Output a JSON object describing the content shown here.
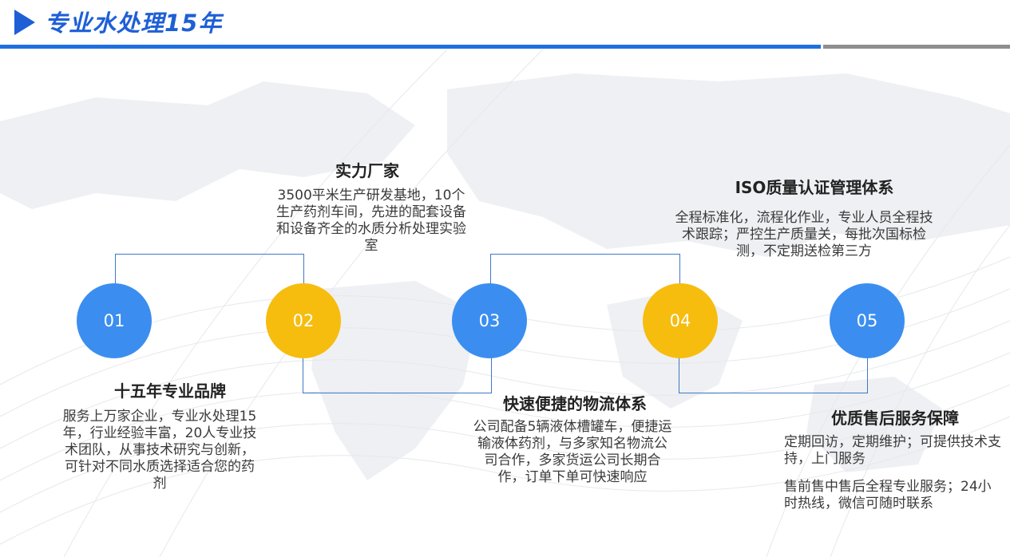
{
  "header": {
    "title": "专业水处理15年"
  },
  "colors": {
    "accent_blue": "#1e5fd6",
    "circle_blue": "#3b8ef0",
    "circle_gold": "#f6bd0e",
    "connector": "#3f78c8"
  },
  "steps": [
    {
      "number": "01",
      "title": "十五年专业品牌",
      "text": "服务上万家企业，专业水处理15年，行业经验丰富，20人专业技术团队，从事技术研究与创新，可针对不同水质选择适合您的药剂"
    },
    {
      "number": "02",
      "title": "实力厂家",
      "text": "3500平米生产研发基地，10个生产药剂车间，先进的配套设备和设备齐全的水质分析处理实验室"
    },
    {
      "number": "03",
      "title": "快速便捷的物流体系",
      "text": "公司配备5辆液体槽罐车，便捷运输液体药剂，与多家知名物流公司合作，多家货运公司长期合作，订单下单可快速响应"
    },
    {
      "number": "04",
      "title": "ISO质量认证管理体系",
      "text": "全程标准化，流程化作业，专业人员全程技术跟踪；严控生产质量关，每批次国标检测，不定期送检第三方"
    },
    {
      "number": "05",
      "title": "优质售后服务保障",
      "text": "定期回访，定期维护；可提供技术支持，上门服务",
      "text2": "售前售中售后全程专业服务；24小时热线，微信可随时联系"
    }
  ]
}
